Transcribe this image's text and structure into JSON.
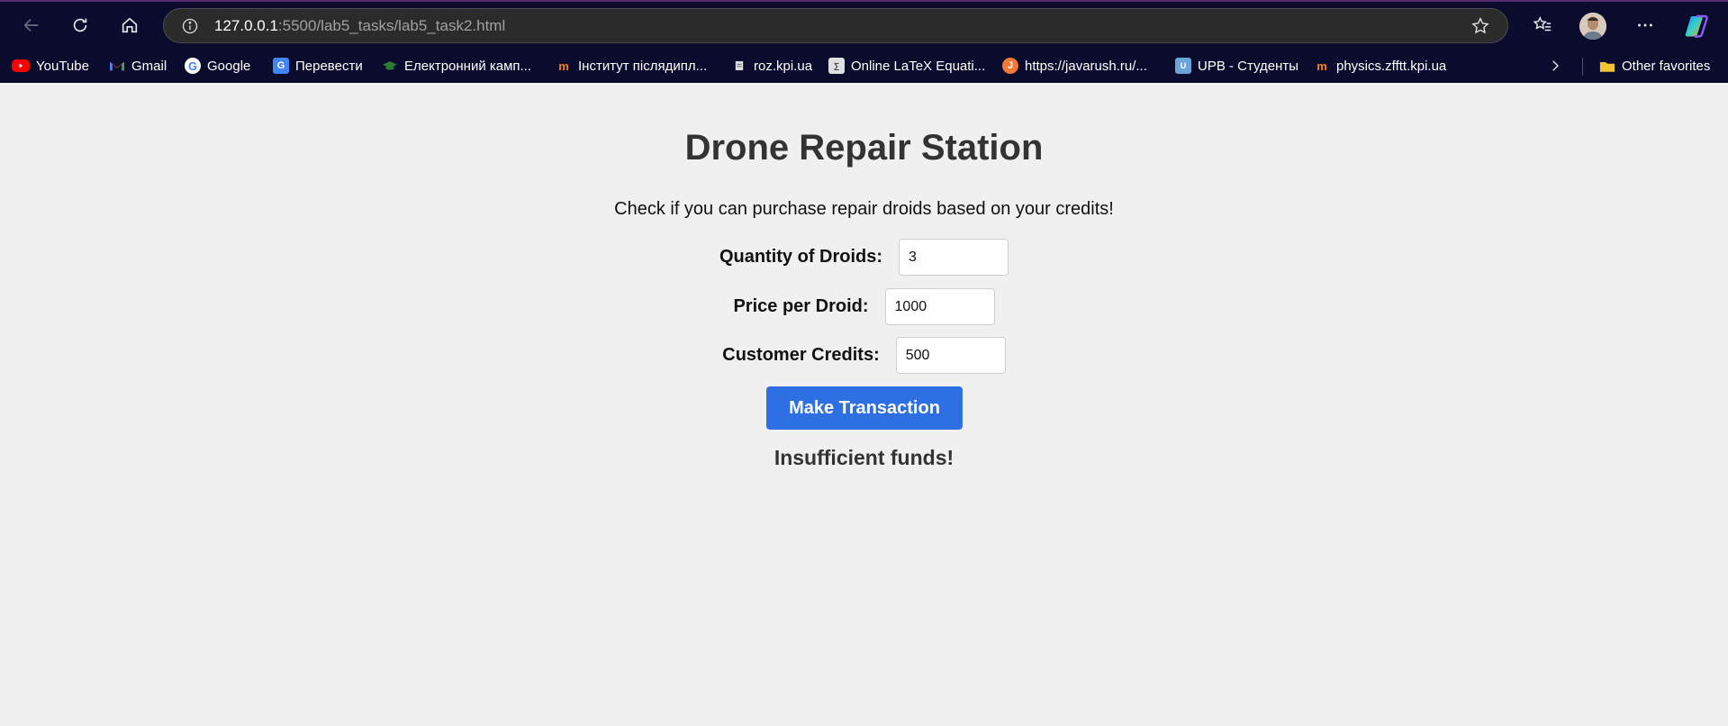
{
  "browser": {
    "url_host": "127.0.0.1",
    "url_path": ":5500/lab5_tasks/lab5_task2.html",
    "bookmarks": [
      {
        "label": "YouTube",
        "icon": "youtube-icon"
      },
      {
        "label": "Gmail",
        "icon": "gmail-icon"
      },
      {
        "label": "Google",
        "icon": "google-icon"
      },
      {
        "label": "Перевести",
        "icon": "translate-icon"
      },
      {
        "label": "Електронний камп...",
        "icon": "graduation-cap-icon"
      },
      {
        "label": "Інститут післядипл...",
        "icon": "moodle-icon"
      },
      {
        "label": "roz.kpi.ua",
        "icon": "page-icon"
      },
      {
        "label": "Online LaTeX Equati...",
        "icon": "latex-icon"
      },
      {
        "label": "https://javarush.ru/...",
        "icon": "javarush-icon"
      },
      {
        "label": "UPB - Студенты",
        "icon": "upb-icon"
      },
      {
        "label": "physics.zfftt.kpi.ua",
        "icon": "moodle-icon"
      }
    ],
    "other_favorites": "Other favorites"
  },
  "page": {
    "title": "Drone Repair Station",
    "subtitle": "Check if you can purchase repair droids based on your credits!",
    "fields": {
      "quantity": {
        "label": "Quantity of Droids:",
        "value": "3"
      },
      "price": {
        "label": "Price per Droid:",
        "value": "1000"
      },
      "credits": {
        "label": "Customer Credits:",
        "value": "500"
      }
    },
    "button_label": "Make Transaction",
    "result": "Insufficient funds!"
  },
  "colors": {
    "chrome_bg": "#0b0b2e",
    "page_bg": "#f0f0f0",
    "button": "#2f6fe4",
    "title_text": "#333333"
  }
}
